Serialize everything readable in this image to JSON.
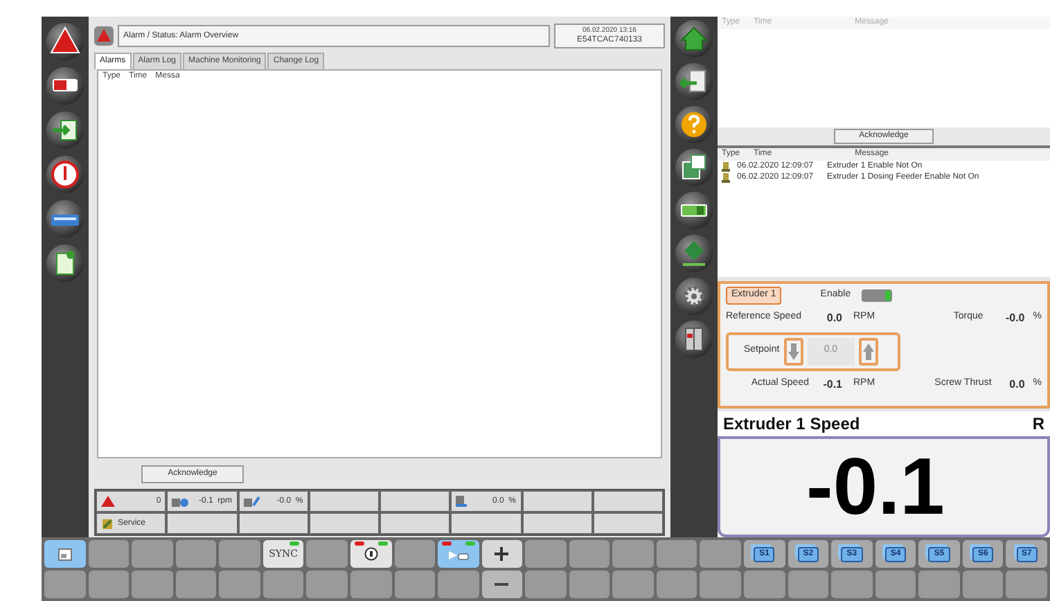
{
  "header": {
    "breadcrumb": "Alarm / Status: Alarm Overview",
    "date": "06.02.2020 13:16",
    "machine_id": "E54TCAC740133"
  },
  "tabs": [
    {
      "label": "Alarms",
      "selected": true
    },
    {
      "label": "Alarm Log",
      "selected": false
    },
    {
      "label": "Machine Monitoring",
      "selected": false
    },
    {
      "label": "Change Log",
      "selected": false
    }
  ],
  "alarm_table": {
    "columns": [
      "Type",
      "Time",
      "Messa"
    ]
  },
  "acknowledge_button": "Acknowledge",
  "status_grid": [
    [
      {
        "kind": "alarm",
        "value": "0"
      },
      {
        "kind": "speed",
        "value": "-0.1  rpm"
      },
      {
        "kind": "torque",
        "value": "-0.0  %"
      },
      {
        "kind": "empty"
      },
      {
        "kind": "empty"
      },
      {
        "kind": "thrust",
        "value": "0.0  %"
      },
      {
        "kind": "empty"
      },
      {
        "kind": "empty"
      }
    ],
    [
      {
        "kind": "service",
        "value": "Service"
      },
      {
        "kind": "empty"
      },
      {
        "kind": "empty"
      },
      {
        "kind": "empty"
      },
      {
        "kind": "empty"
      },
      {
        "kind": "empty"
      },
      {
        "kind": "empty"
      },
      {
        "kind": "empty"
      }
    ]
  ],
  "active_alarms": {
    "columns": [
      "Type",
      "Time",
      "Message"
    ],
    "acknowledge_button": "Acknowledge"
  },
  "alarm_history": {
    "columns": [
      "Type",
      "Time",
      "Message"
    ],
    "rows": [
      {
        "time": "06.02.2020 12:09:07",
        "message": "Extruder 1 Enable Not On"
      },
      {
        "time": "06.02.2020 12:09:07",
        "message": "Extruder 1 Dosing Feeder Enable Not On"
      }
    ]
  },
  "extruder": {
    "name": "Extruder 1",
    "enable_label": "Enable",
    "enabled": false,
    "reference_speed": {
      "label": "Reference Speed",
      "value": "0.0",
      "unit": "RPM"
    },
    "torque": {
      "label": "Torque",
      "value": "-0.0",
      "unit": "%"
    },
    "setpoint": {
      "label": "Setpoint",
      "value": "0.0"
    },
    "actual_speed": {
      "label": "Actual Speed",
      "value": "-0.1",
      "unit": "RPM"
    },
    "screw_thrust": {
      "label": "Screw Thrust",
      "value": "0.0",
      "unit": "%"
    }
  },
  "speed_display": {
    "title": "Extruder 1 Speed",
    "unit": "R",
    "value": "-0.1"
  },
  "function_keys": [
    [
      {
        "kind": "image",
        "selected": true
      },
      {
        "kind": "blank"
      },
      {
        "kind": "blank"
      },
      {
        "kind": "blank"
      },
      {
        "kind": "blank"
      },
      {
        "kind": "text",
        "label": "SYNC",
        "alarm_led": false,
        "ok_led": true
      },
      {
        "kind": "blank"
      },
      {
        "kind": "lock",
        "alarm_led": true,
        "ok_led": true
      },
      {
        "kind": "blank"
      },
      {
        "kind": "valve",
        "selected": true,
        "alarm_led": true,
        "ok_led": true
      },
      {
        "kind": "plus"
      },
      {
        "kind": "blank"
      },
      {
        "kind": "blank"
      },
      {
        "kind": "blank"
      },
      {
        "kind": "blank"
      },
      {
        "kind": "blank"
      },
      {
        "kind": "screen",
        "label": "S1"
      },
      {
        "kind": "screen",
        "label": "S2"
      },
      {
        "kind": "screen",
        "label": "S3"
      },
      {
        "kind": "screen",
        "label": "S4"
      },
      {
        "kind": "screen",
        "label": "S5"
      },
      {
        "kind": "screen",
        "label": "S6"
      },
      {
        "kind": "screen",
        "label": "S7"
      }
    ],
    [
      {
        "kind": "blank"
      },
      {
        "kind": "blank"
      },
      {
        "kind": "blank"
      },
      {
        "kind": "blank"
      },
      {
        "kind": "blank"
      },
      {
        "kind": "blank"
      },
      {
        "kind": "blank"
      },
      {
        "kind": "blank"
      },
      {
        "kind": "blank"
      },
      {
        "kind": "blank"
      },
      {
        "kind": "minus"
      },
      {
        "kind": "blank"
      },
      {
        "kind": "blank"
      },
      {
        "kind": "blank"
      },
      {
        "kind": "blank"
      },
      {
        "kind": "blank"
      },
      {
        "kind": "blank"
      },
      {
        "kind": "blank"
      },
      {
        "kind": "blank"
      },
      {
        "kind": "blank"
      },
      {
        "kind": "blank"
      },
      {
        "kind": "blank"
      },
      {
        "kind": "blank"
      }
    ]
  ]
}
